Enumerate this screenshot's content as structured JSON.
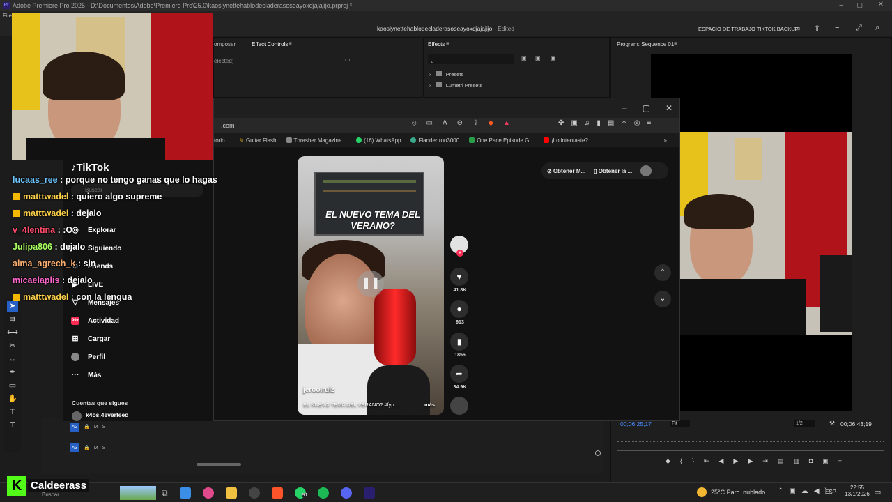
{
  "premiere": {
    "title": "Adobe Premiere Pro 2025 - D:\\Documentos\\Adobe\\Premiere Pro\\25.0\\kaoslynettehablodecladerasoseayoxdjajajijo.prproj *",
    "menu_first": "File",
    "project_name": "kaoslynettehablodecladerasoseayoxdjajajijo",
    "project_status": "- Edited",
    "workspace": "ESPACIO DE TRABAJO TIKTOK BACKUP",
    "tab_composer": "omposer",
    "tab_effect_controls": "Effect Controls",
    "effect_controls_note": "elected)",
    "effects_tab": "Effects",
    "effects_items": [
      "Presets",
      "Lumetri Presets"
    ],
    "program_tab": "Program: Sequence 01",
    "timecode_left": "00;06;25;17",
    "fit": "Fit",
    "quality": "1/2",
    "timecode_right": "00;06;43;19",
    "tracks": [
      "A2",
      "A3"
    ],
    "sequence_tab": "Sequence 01"
  },
  "browser": {
    "url": ".com",
    "bookmarks": [
      {
        "label": "torio...",
        "color": "#888888"
      },
      {
        "label": "Guitar Flash",
        "color": "#d0a020"
      },
      {
        "label": "Thrasher Magazine...",
        "color": "#888888"
      },
      {
        "label": "(16) WhatsApp",
        "color": "#25d366"
      },
      {
        "label": "Flandertron3000",
        "color": "#3aa88a"
      },
      {
        "label": "One Pace Episode G...",
        "color": "#2a9d4a"
      },
      {
        "label": "¡Lo intentaste?",
        "color": "#ff0000"
      }
    ],
    "header_buttons": [
      "Obtener M...",
      "Obtener la ..."
    ]
  },
  "tiktok": {
    "logo": "TikTok",
    "search_placeholder": "Buscar",
    "nav": [
      {
        "label": "Explorar",
        "icon": "compass-icon"
      },
      {
        "label": "Siguiendo",
        "icon": "following-icon"
      },
      {
        "label": "Friends",
        "icon": "friends-icon"
      },
      {
        "label": "LIVE",
        "icon": "live-icon"
      },
      {
        "label": "Mensajes",
        "icon": "messages-icon"
      },
      {
        "label": "Actividad",
        "icon": "activity-icon",
        "badge": "99+"
      },
      {
        "label": "Cargar",
        "icon": "upload-icon"
      },
      {
        "label": "Perfil",
        "icon": "profile-icon"
      },
      {
        "label": "Más",
        "icon": "more-icon"
      }
    ],
    "following_heading": "Cuentas que sigues",
    "following_first": "k4os.4everfeed",
    "video": {
      "overlay_title": "EL NUEVO TEMA DEL VERANO?",
      "author": "jeroo.ruiz",
      "caption": "EL NUEVO TEMA DEL VERANO? #fyp ...",
      "more": "más"
    },
    "actions": {
      "likes": "41.8K",
      "comments": "913",
      "saves": "1856",
      "shares": "34.9K"
    }
  },
  "chat": [
    {
      "user": "lucaas_ree",
      "msg": ": porque no tengo ganas que lo hagas",
      "color": "#6ec6ff",
      "badge": false
    },
    {
      "user": "matttwadel",
      "msg": ": quiero algo supreme",
      "color": "#ffd24a",
      "badge": true
    },
    {
      "user": "matttwadel",
      "msg": ": dejalo",
      "color": "#ffd24a",
      "badge": true
    },
    {
      "user": "v_4lentina",
      "msg": ": :O",
      "color": "#ff4a6a",
      "badge": false
    },
    {
      "user": "Julipa806",
      "msg": ": dejalo",
      "color": "#a8ff60",
      "badge": false
    },
    {
      "user": "alma_agrech_k",
      "msg": ": sin",
      "color": "#ffb070",
      "badge": false
    },
    {
      "user": "micaelaplis",
      "msg": ": dejalo",
      "color": "#ff66cc",
      "badge": false
    },
    {
      "user": "matttwadel",
      "msg": ": con la lengua",
      "color": "#ffd24a",
      "badge": true
    }
  ],
  "taskbar": {
    "streamer": "Caldeerass",
    "search": "Buscar",
    "weather": "25°C  Parc. nublado",
    "lang": "ESP",
    "time": "22:55",
    "date": "13/1/2026",
    "whatsapp_badge": "91"
  }
}
